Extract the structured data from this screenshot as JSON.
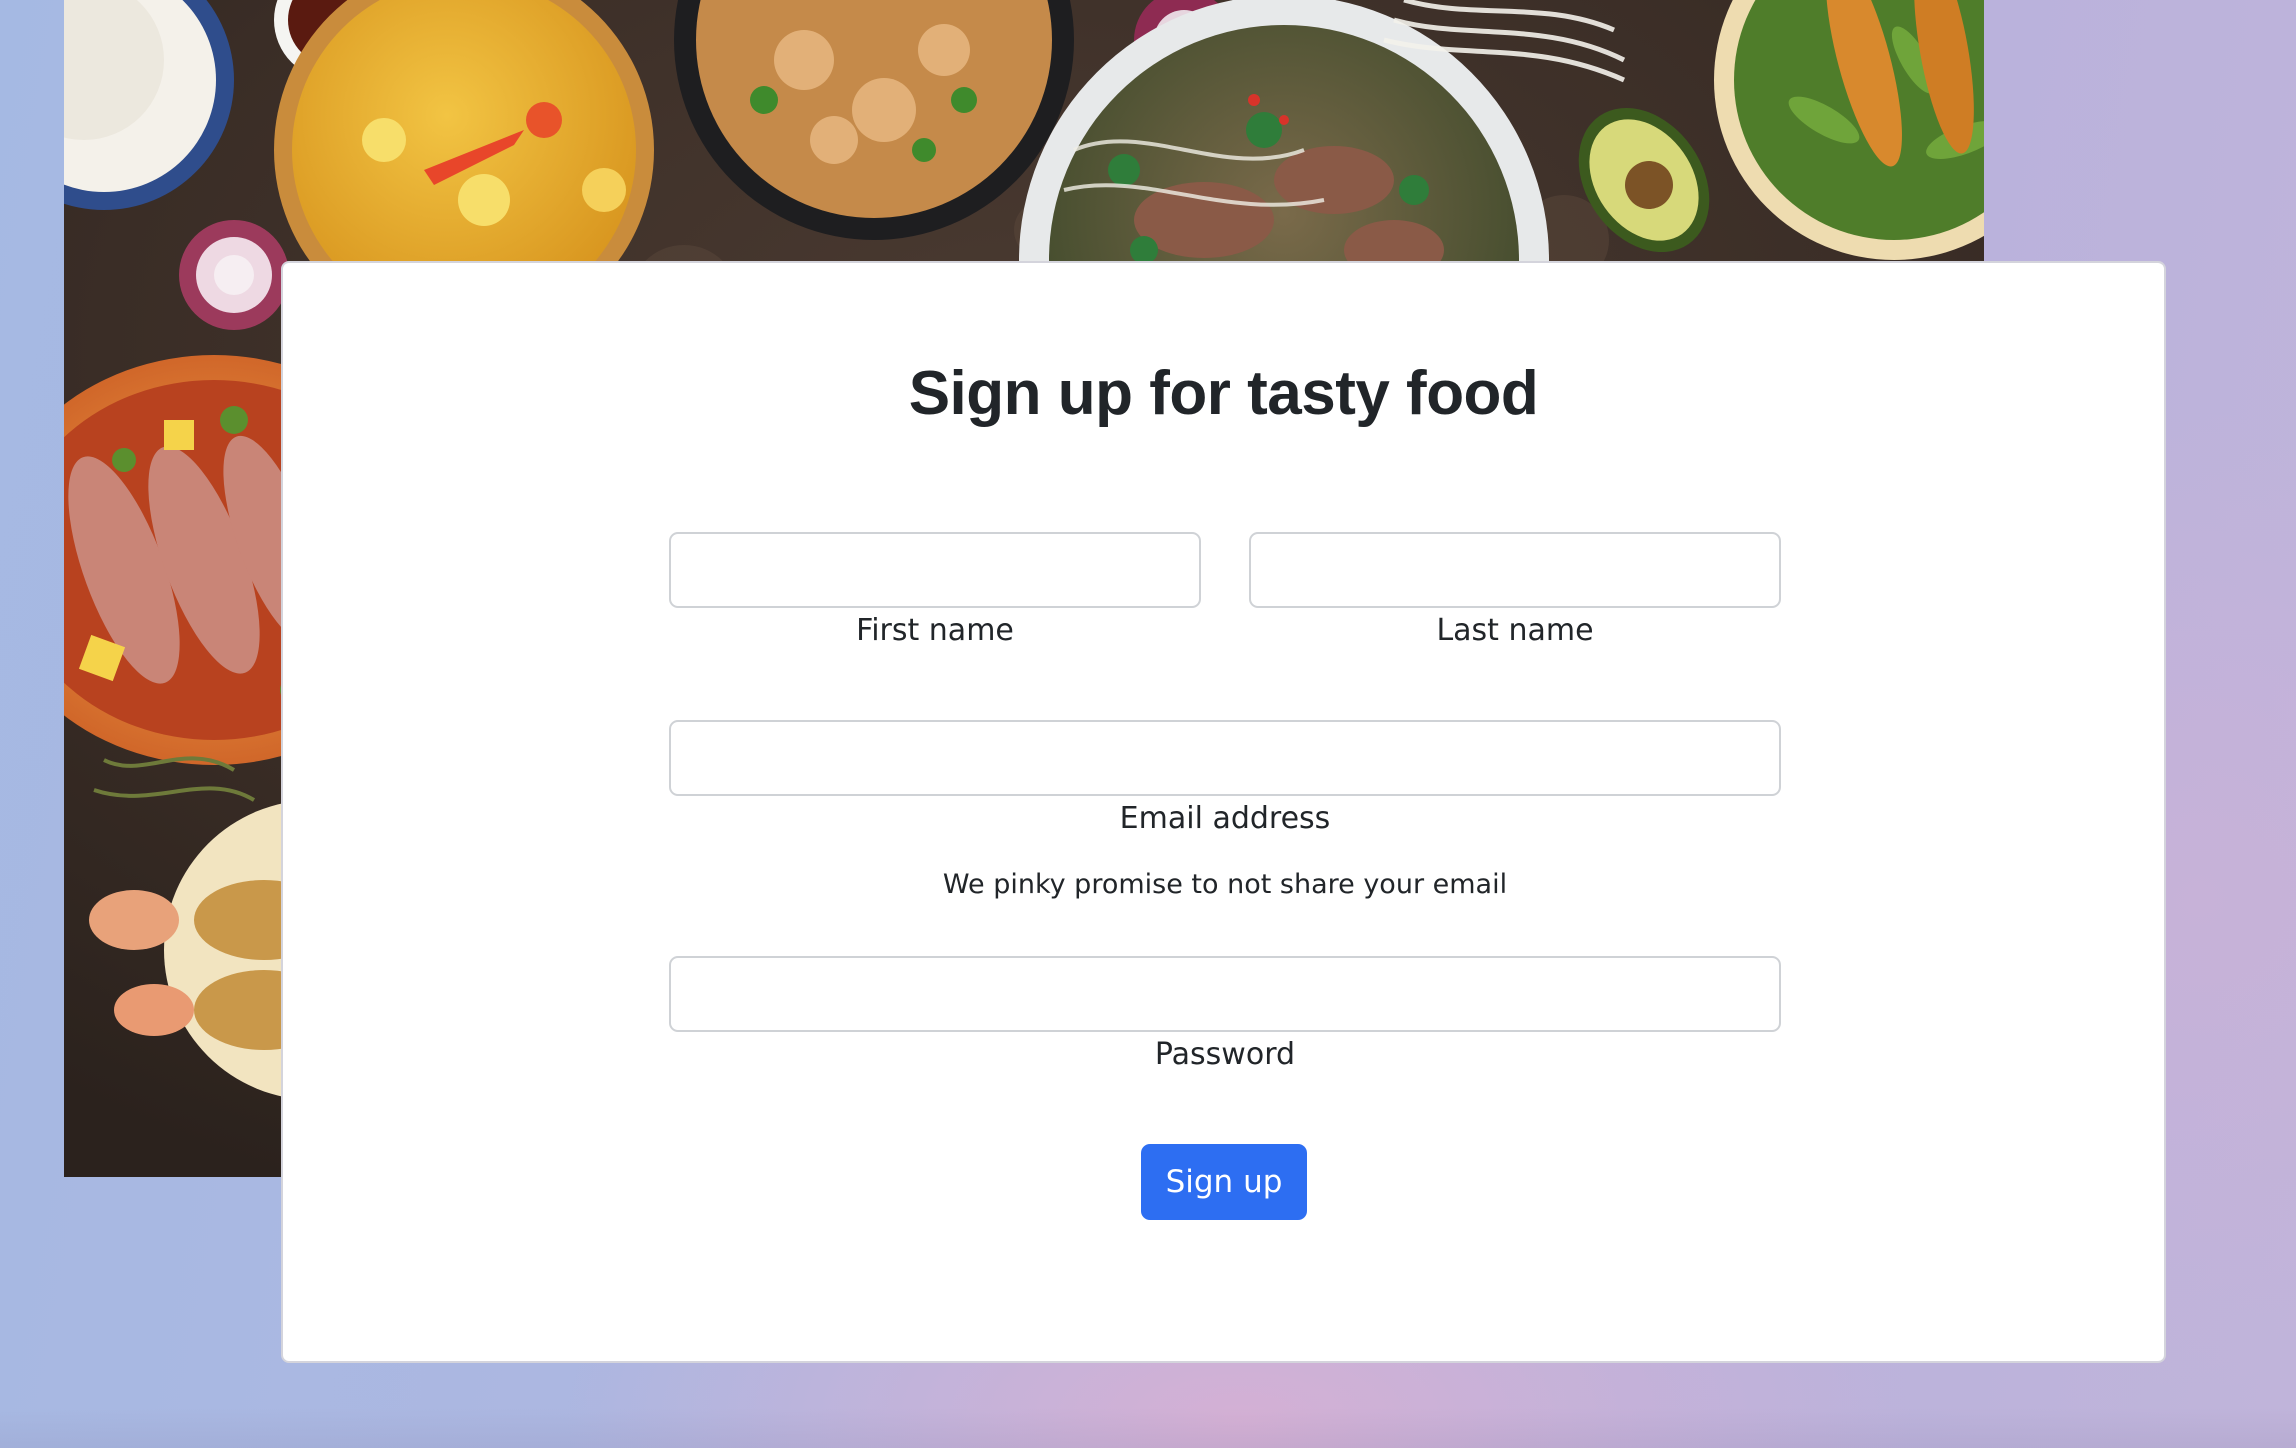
{
  "page": {
    "title": "Sign up for tasty food"
  },
  "form": {
    "first_name": {
      "label": "First name",
      "value": "",
      "placeholder": ""
    },
    "last_name": {
      "label": "Last name",
      "value": "",
      "placeholder": ""
    },
    "email": {
      "label": "Email address",
      "hint": "We pinky promise to not share your email",
      "value": "",
      "placeholder": ""
    },
    "password": {
      "label": "Password",
      "value": "",
      "placeholder": ""
    },
    "submit_label": "Sign up"
  },
  "colors": {
    "accent": "#2d6ef2",
    "text": "#212529",
    "card_background": "#ffffff"
  }
}
